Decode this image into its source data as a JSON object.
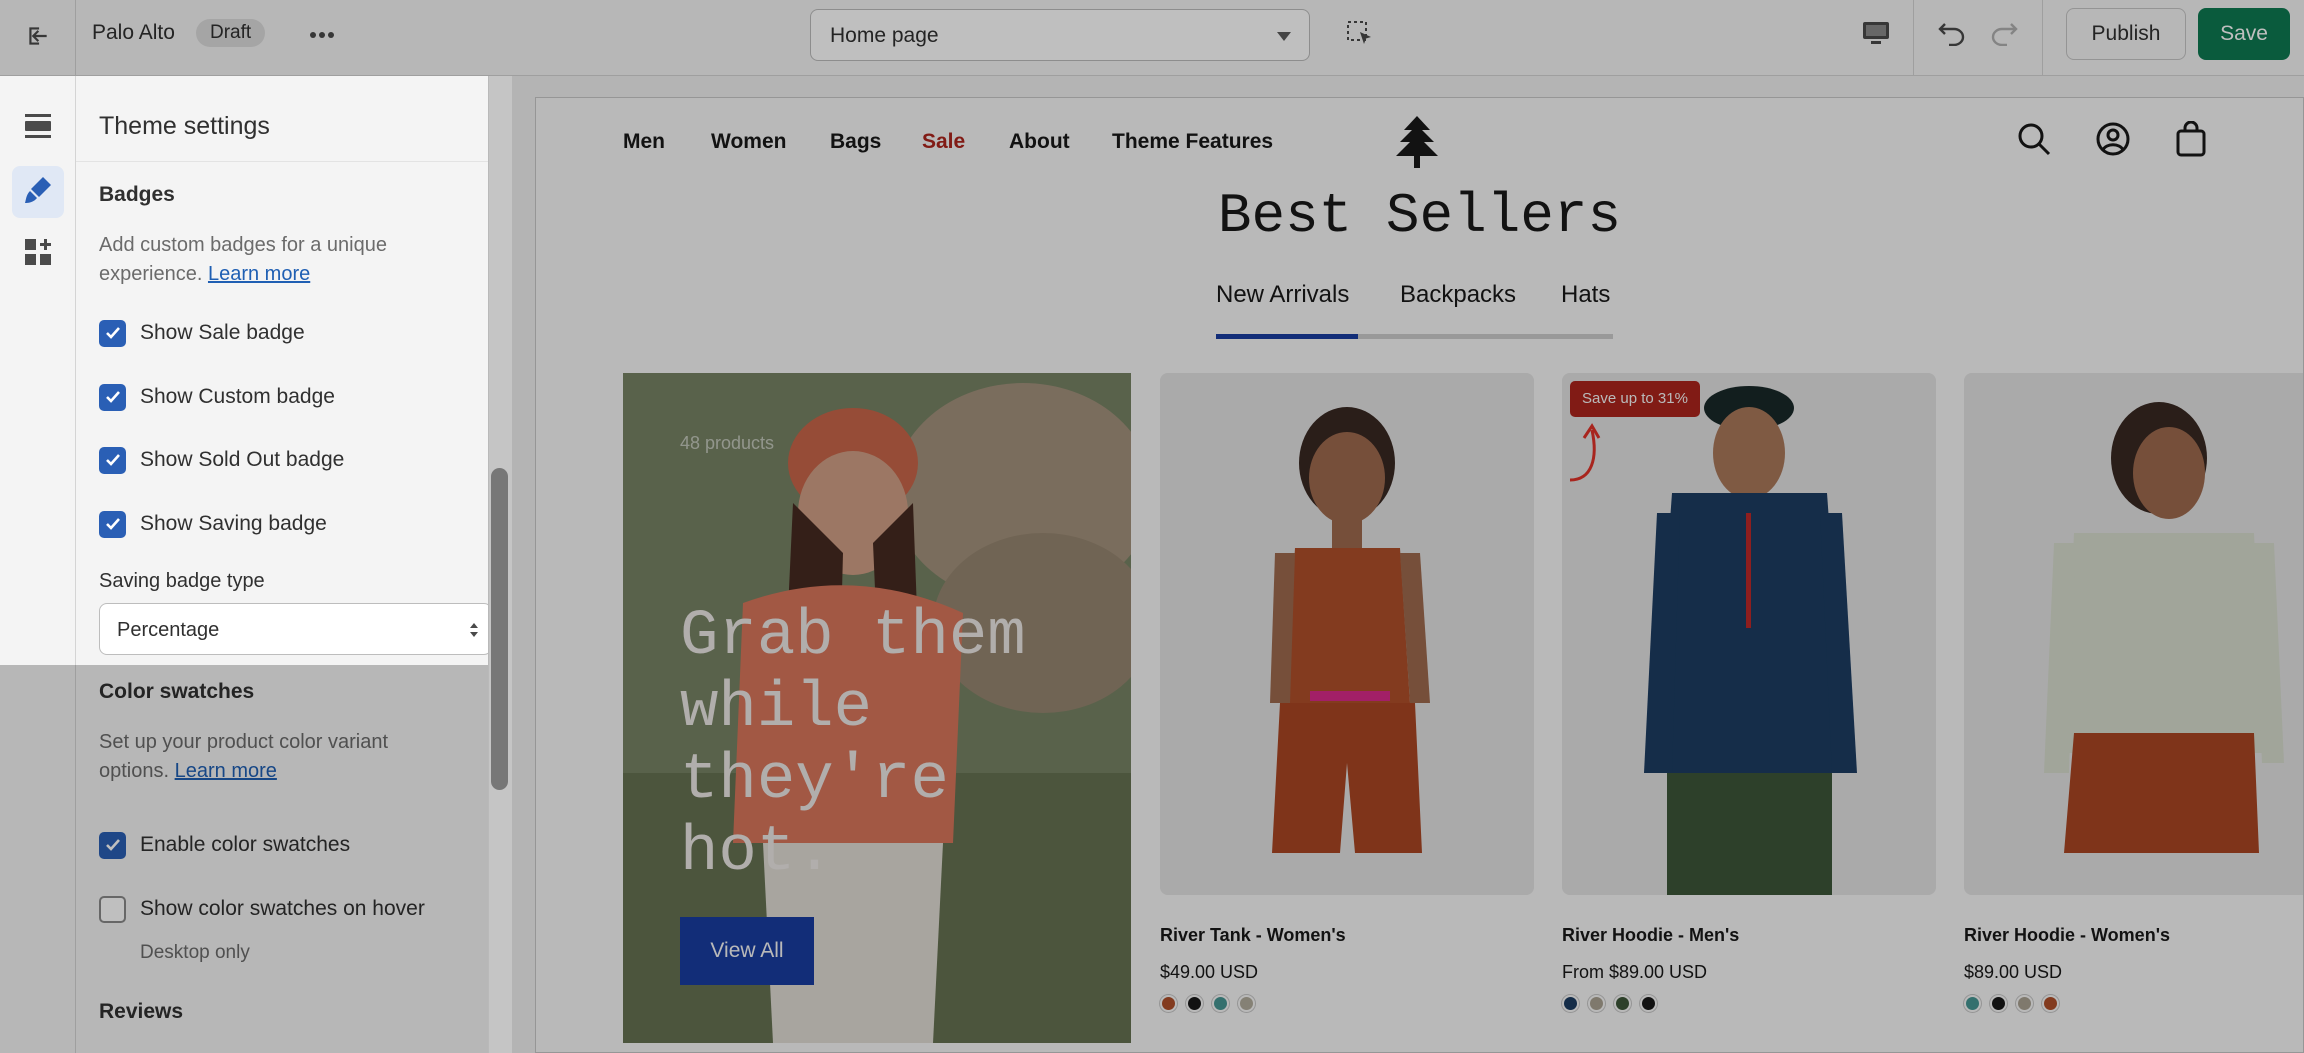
{
  "topbar": {
    "store_name": "Palo Alto",
    "status_badge": "Draft",
    "page_selector": "Home page",
    "publish_label": "Publish",
    "save_label": "Save"
  },
  "panel": {
    "title": "Theme settings",
    "badges": {
      "title": "Badges",
      "help": "Add custom badges for a unique experience.",
      "help_link": "Learn more",
      "checks": [
        {
          "label": "Show Sale badge",
          "checked": true
        },
        {
          "label": "Show Custom badge",
          "checked": true
        },
        {
          "label": "Show Sold Out badge",
          "checked": true
        },
        {
          "label": "Show Saving badge",
          "checked": true
        }
      ],
      "saving_type_label": "Saving badge type",
      "saving_type_value": "Percentage"
    },
    "swatches": {
      "title": "Color swatches",
      "help": "Set up your product color variant options.",
      "help_link": "Learn more",
      "checks": [
        {
          "label": "Enable color swatches",
          "checked": true
        },
        {
          "label": "Show color swatches on hover",
          "checked": false
        }
      ],
      "hover_note": "Desktop only"
    },
    "reviews_title": "Reviews"
  },
  "preview": {
    "nav": [
      "Men",
      "Women",
      "Bags",
      "Sale",
      "About",
      "Theme Features"
    ],
    "heading": "Best Sellers",
    "tabs": [
      "New Arrivals",
      "Backpacks",
      "Hats"
    ],
    "hero": {
      "products_count": "48 products",
      "heading": "Grab them while they're hot.",
      "button": "View All"
    },
    "products": [
      {
        "title": "River Tank - Women's",
        "price": "$49.00 USD",
        "swatches": [
          "#b5532c",
          "#1a1a1a",
          "#4a9c99",
          "#b8b2a2"
        ]
      },
      {
        "title": "River Hoodie - Men's",
        "price": "From $89.00 USD",
        "badge": "Save up to 31%",
        "swatches": [
          "#1e3f66",
          "#b0a898",
          "#3f5a3a",
          "#1a1a1a"
        ]
      },
      {
        "title": "River Hoodie - Women's",
        "price": "$89.00 USD",
        "swatches": [
          "#4a9c99",
          "#1a1a1a",
          "#b0a898",
          "#b5532c"
        ]
      }
    ]
  },
  "colors": {
    "accent_blue": "#1a3fa6",
    "save_green": "#0e7a52",
    "sale_red": "#b3261e",
    "checkbox_blue": "#2a5fb5"
  }
}
